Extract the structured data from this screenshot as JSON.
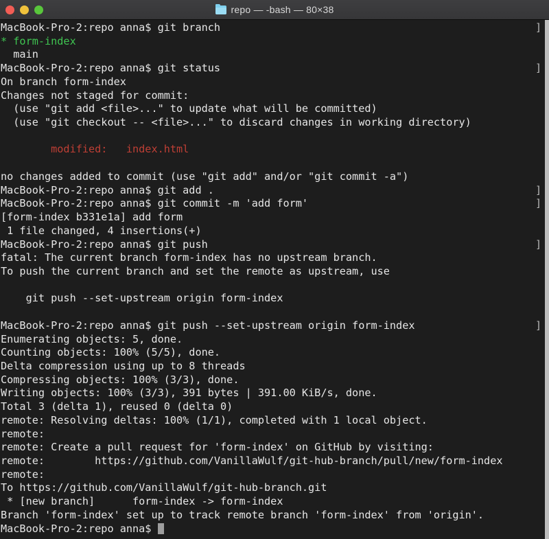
{
  "window": {
    "title": "repo — -bash — 80×38",
    "folder_icon": "folder-icon",
    "traffic_lights": {
      "close": "close-button",
      "minimize": "minimize-button",
      "maximize": "maximize-button",
      "close_color": "#f25d55",
      "minimize_color": "#f0c23c",
      "maximize_color": "#59c63c"
    }
  },
  "theme": {
    "background": "#1d1d1d",
    "foreground": "#e6e6e6",
    "titlebar": "#3a3a3c",
    "green": "#3fc451",
    "red": "#bf3f35",
    "cursor": "#9d9d9d"
  },
  "terminal": {
    "prompt": "MacBook-Pro-2:repo anna$ ",
    "prompt_mark": "]",
    "cursor_glyph": "block-cursor",
    "lines": [
      {
        "text": "MacBook-Pro-2:repo anna$ git branch",
        "prompt": true
      },
      {
        "text": "* form-index",
        "color": "green"
      },
      {
        "text": "  main"
      },
      {
        "text": "MacBook-Pro-2:repo anna$ git status",
        "prompt": true
      },
      {
        "text": "On branch form-index"
      },
      {
        "text": "Changes not staged for commit:"
      },
      {
        "text": "  (use \"git add <file>...\" to update what will be committed)"
      },
      {
        "text": "  (use \"git checkout -- <file>...\" to discard changes in working directory)"
      },
      {
        "text": ""
      },
      {
        "text": "        modified:   index.html",
        "color": "red"
      },
      {
        "text": ""
      },
      {
        "text": "no changes added to commit (use \"git add\" and/or \"git commit -a\")"
      },
      {
        "text": "MacBook-Pro-2:repo anna$ git add .",
        "prompt": true
      },
      {
        "text": "MacBook-Pro-2:repo anna$ git commit -m 'add form'",
        "prompt": true
      },
      {
        "text": "[form-index b331e1a] add form"
      },
      {
        "text": " 1 file changed, 4 insertions(+)"
      },
      {
        "text": "MacBook-Pro-2:repo anna$ git push",
        "prompt": true
      },
      {
        "text": "fatal: The current branch form-index has no upstream branch."
      },
      {
        "text": "To push the current branch and set the remote as upstream, use"
      },
      {
        "text": ""
      },
      {
        "text": "    git push --set-upstream origin form-index"
      },
      {
        "text": ""
      },
      {
        "text": "MacBook-Pro-2:repo anna$ git push --set-upstream origin form-index",
        "prompt": true
      },
      {
        "text": "Enumerating objects: 5, done."
      },
      {
        "text": "Counting objects: 100% (5/5), done."
      },
      {
        "text": "Delta compression using up to 8 threads"
      },
      {
        "text": "Compressing objects: 100% (3/3), done."
      },
      {
        "text": "Writing objects: 100% (3/3), 391 bytes | 391.00 KiB/s, done."
      },
      {
        "text": "Total 3 (delta 1), reused 0 (delta 0)"
      },
      {
        "text": "remote: Resolving deltas: 100% (1/1), completed with 1 local object."
      },
      {
        "text": "remote:"
      },
      {
        "text": "remote: Create a pull request for 'form-index' on GitHub by visiting:"
      },
      {
        "text": "remote:        https://github.com/VanillaWulf/git-hub-branch/pull/new/form-index"
      },
      {
        "text": "remote:"
      },
      {
        "text": "To https://github.com/VanillaWulf/git-hub-branch.git"
      },
      {
        "text": " * [new branch]      form-index -> form-index"
      },
      {
        "text": "Branch 'form-index' set up to track remote branch 'form-index' from 'origin'."
      },
      {
        "text": "MacBook-Pro-2:repo anna$ ",
        "prompt": false,
        "cursor": true
      }
    ]
  }
}
